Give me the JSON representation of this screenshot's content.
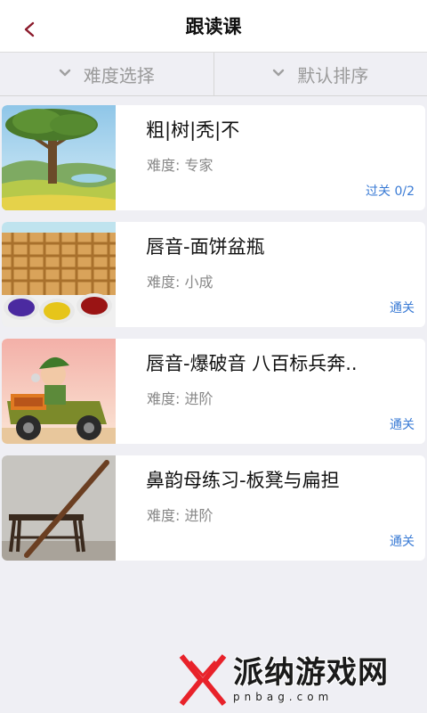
{
  "header": {
    "title": "跟读课"
  },
  "filters": {
    "difficulty_label": "难度选择",
    "sort_label": "默认排序"
  },
  "colors": {
    "accent_blue": "#3a7bd5",
    "watermark_red": "#e8222a"
  },
  "courses": [
    {
      "title": "粗|树|秃|不",
      "difficulty": "难度: 专家",
      "status": "过关 0/2"
    },
    {
      "title": "唇音-面饼盆瓶",
      "difficulty": "难度: 小成",
      "status": "通关"
    },
    {
      "title": "唇音-爆破音 八百标兵奔..",
      "difficulty": "难度: 进阶",
      "status": "通关"
    },
    {
      "title": "鼻韵母练习-板凳与扁担",
      "difficulty": "难度: 进阶",
      "status": "通关"
    }
  ],
  "watermark": {
    "title": "派纳游戏网",
    "subtitle": "pnbag.com"
  }
}
